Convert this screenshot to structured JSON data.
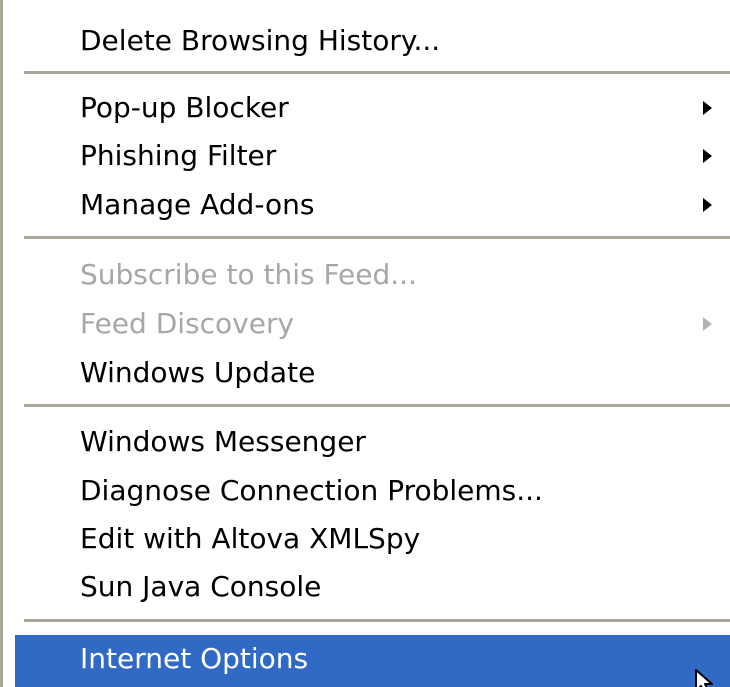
{
  "menu": {
    "items": [
      {
        "label": "Delete Browsing History..."
      },
      {
        "label": "Pop-up Blocker"
      },
      {
        "label": "Phishing Filter"
      },
      {
        "label": "Manage Add-ons"
      },
      {
        "label": "Subscribe to this Feed..."
      },
      {
        "label": "Feed Discovery"
      },
      {
        "label": "Windows Update"
      },
      {
        "label": "Windows Messenger"
      },
      {
        "label": "Diagnose Connection Problems..."
      },
      {
        "label": "Edit with Altova XMLSpy"
      },
      {
        "label": "Sun Java Console"
      },
      {
        "label": "Internet Options"
      }
    ]
  },
  "colors": {
    "highlight": "#316ac5",
    "disabled_text": "#a7a7a7",
    "separator": "#aca899"
  }
}
